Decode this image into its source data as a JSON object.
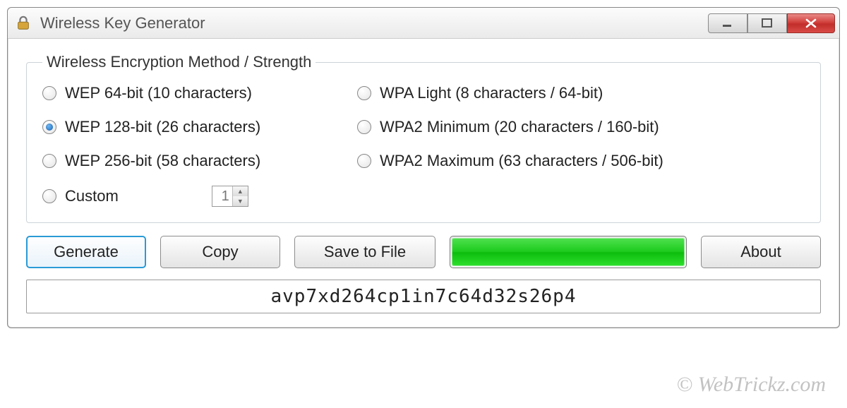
{
  "window": {
    "title": "Wireless Key Generator"
  },
  "group": {
    "legend": "Wireless Encryption Method / Strength",
    "options": {
      "wep64": "WEP 64-bit (10 characters)",
      "wep128": "WEP 128-bit (26 characters)",
      "wep256": "WEP 256-bit (58 characters)",
      "wpalight": "WPA Light (8 characters / 64-bit)",
      "wpa2min": "WPA2 Minimum (20 characters / 160-bit)",
      "wpa2max": "WPA2 Maximum (63 characters / 506-bit)",
      "custom": "Custom"
    },
    "selected": "wep128",
    "custom_length": "1"
  },
  "buttons": {
    "generate": "Generate",
    "copy": "Copy",
    "save": "Save to File",
    "about": "About"
  },
  "output": {
    "key": "avp7xd264cp1in7c64d32s26p4"
  },
  "progress": {
    "percent": 100
  },
  "watermark": "© WebTrickz.com"
}
